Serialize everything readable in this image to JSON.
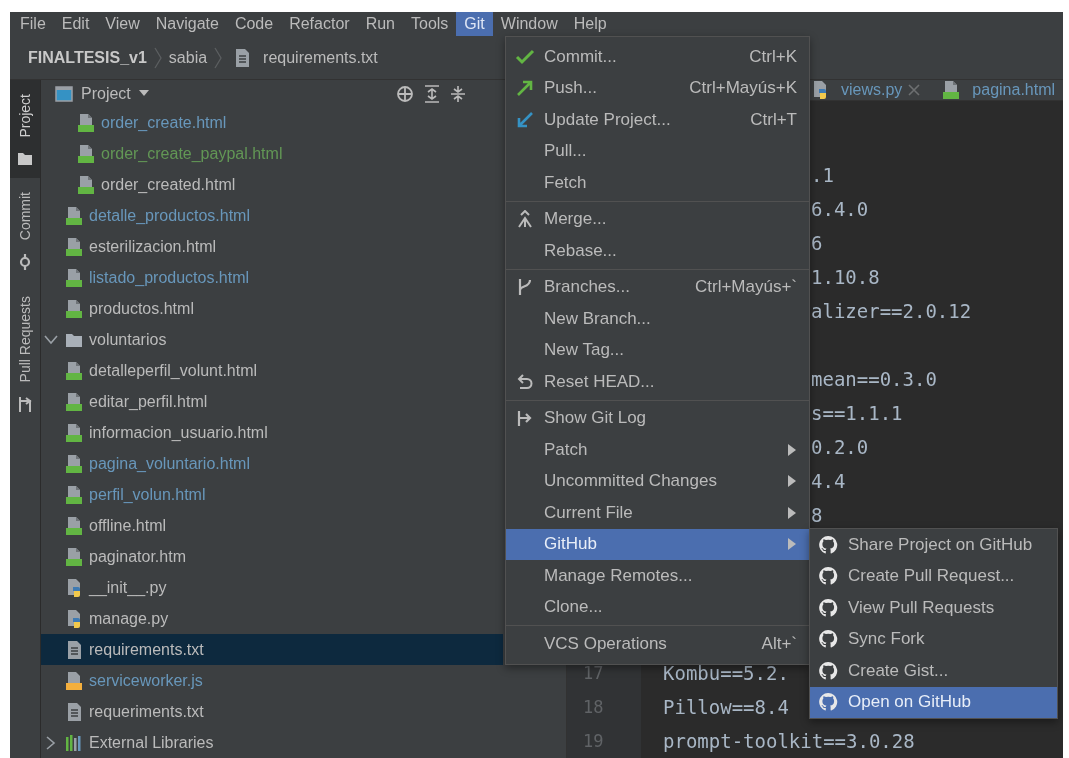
{
  "menu_bar": [
    {
      "label": "File",
      "selected": false
    },
    {
      "label": "Edit",
      "selected": false
    },
    {
      "label": "View",
      "selected": false
    },
    {
      "label": "Navigate",
      "selected": false
    },
    {
      "label": "Code",
      "selected": false
    },
    {
      "label": "Refactor",
      "selected": false
    },
    {
      "label": "Run",
      "selected": false
    },
    {
      "label": "Tools",
      "selected": false
    },
    {
      "label": "Git",
      "selected": true
    },
    {
      "label": "Window",
      "selected": false
    },
    {
      "label": "Help",
      "selected": false
    }
  ],
  "breadcrumb": [
    {
      "label": "FINALTESIS_v1",
      "kind": "project"
    },
    {
      "label": "sabia",
      "kind": "folder"
    },
    {
      "label": "requirements.txt",
      "kind": "file"
    }
  ],
  "tool_stripe": [
    {
      "label": "Project",
      "kind": "folder",
      "selected": true
    },
    {
      "label": "Commit",
      "kind": "commit",
      "selected": false
    },
    {
      "label": "Pull Requests",
      "kind": "pullrequest",
      "selected": false
    }
  ],
  "project_panel": {
    "title": "Project",
    "tree": [
      {
        "children": [
          {
            "children": [
              {
                "children": [
                  {
                    "children": [
                      {
                        "children": [
                          {
                            "label": "order_create.html",
                            "kind": "html",
                            "color": "#6897bb",
                            "selected": false
                          },
                          {
                            "label": "order_create_paypal.html",
                            "kind": "html",
                            "color": "#629755",
                            "selected": false
                          },
                          {
                            "label": "order_created.html",
                            "kind": "html",
                            "color": "#bbbbbb",
                            "selected": false
                          }
                        ]
                      },
                      {
                        "label": "detalle_productos.html",
                        "kind": "html",
                        "color": "#6897bb",
                        "selected": false
                      },
                      {
                        "label": "esterilizacion.html",
                        "kind": "html",
                        "color": "#bbbbbb",
                        "selected": false
                      },
                      {
                        "label": "listado_productos.html",
                        "kind": "html",
                        "color": "#6897bb",
                        "selected": false
                      },
                      {
                        "label": "productos.html",
                        "kind": "html",
                        "color": "#bbbbbb",
                        "selected": false
                      }
                    ]
                  },
                  {
                    "label": "voluntarios",
                    "kind": "folder",
                    "color": "#bbbbbb",
                    "selected": false,
                    "expanded": true,
                    "children": [
                      {
                        "label": "detalleperfil_volunt.html",
                        "kind": "html",
                        "color": "#bbbbbb",
                        "selected": false
                      },
                      {
                        "label": "editar_perfil.html",
                        "kind": "html",
                        "color": "#bbbbbb",
                        "selected": false
                      },
                      {
                        "label": "informacion_usuario.html",
                        "kind": "html",
                        "color": "#bbbbbb",
                        "selected": false
                      },
                      {
                        "label": "pagina_voluntario.html",
                        "kind": "html",
                        "color": "#6897bb",
                        "selected": false
                      },
                      {
                        "label": "perfil_volun.html",
                        "kind": "html",
                        "color": "#6897bb",
                        "selected": false
                      }
                    ]
                  },
                  {
                    "label": "offline.html",
                    "kind": "html",
                    "color": "#bbbbbb",
                    "selected": false
                  },
                  {
                    "label": "paginator.htm",
                    "kind": "html",
                    "color": "#bbbbbb",
                    "selected": false
                  }
                ]
              },
              {
                "label": "__init__.py",
                "kind": "python",
                "color": "#bbbbbb",
                "selected": false
              },
              {
                "label": "manage.py",
                "kind": "python",
                "color": "#bbbbbb",
                "selected": false
              },
              {
                "label": "requirements.txt",
                "kind": "text",
                "color": "#bbbbbb",
                "selected": true
              },
              {
                "label": "serviceworker.js",
                "kind": "js",
                "color": "#6897bb",
                "selected": false
              }
            ]
          },
          {
            "label": "requeriments.txt",
            "kind": "text",
            "color": "#bbbbbb",
            "selected": false
          }
        ]
      },
      {
        "label": "External Libraries",
        "kind": "library",
        "color": "#bbbbbb",
        "selected": false,
        "expanded": false
      }
    ]
  },
  "editor": {
    "tabs": [
      {
        "label": "views.py",
        "kind": "python",
        "color": "#6897bb",
        "closable": true
      },
      {
        "label": "pagina.html",
        "kind": "html",
        "color": "#6897bb",
        "closable": false
      }
    ],
    "line_blocks": [
      [
        {
          "text": ".1"
        },
        {
          "text": "6.4.0"
        },
        {
          "text": "6"
        },
        {
          "text": "1.10.8"
        },
        {
          "text": "alizer==2.0.12"
        }
      ],
      [
        {
          "text": "mean==0.3.0"
        },
        {
          "text": "s==1.1.1"
        },
        {
          "text": "0.2.0"
        },
        {
          "text": "4.4"
        },
        {
          "text": "8"
        }
      ],
      [
        {
          "number": "17",
          "text": "Kombu==5.2."
        },
        {
          "number": "18",
          "text": "Pillow==8.4"
        },
        {
          "number": "19",
          "text": "prompt-toolkit==3.0.28"
        }
      ]
    ]
  },
  "git_menu": {
    "groups": [
      [
        {
          "label": "Commit...",
          "kind": "check",
          "shortcut": "Ctrl+K",
          "submenu": false,
          "selected": false
        },
        {
          "label": "Push...",
          "kind": "push",
          "shortcut": "Ctrl+Mayús+K",
          "submenu": false,
          "selected": false
        },
        {
          "label": "Update Project...",
          "kind": "update",
          "shortcut": "Ctrl+T",
          "submenu": false,
          "selected": false
        },
        {
          "label": "Pull...",
          "kind": "plain",
          "submenu": false,
          "selected": false
        },
        {
          "label": "Fetch",
          "kind": "plain",
          "submenu": false,
          "selected": false
        }
      ],
      [
        {
          "label": "Merge...",
          "kind": "merge",
          "submenu": false,
          "selected": false
        },
        {
          "label": "Rebase...",
          "kind": "plain",
          "submenu": false,
          "selected": false
        }
      ],
      [
        {
          "label": "Branches...",
          "kind": "branch",
          "shortcut": "Ctrl+Mayús+`",
          "submenu": false,
          "selected": false
        },
        {
          "label": "New Branch...",
          "kind": "plain",
          "submenu": false,
          "selected": false
        },
        {
          "label": "New Tag...",
          "kind": "plain",
          "submenu": false,
          "selected": false
        },
        {
          "label": "Reset HEAD...",
          "kind": "reset",
          "submenu": false,
          "selected": false
        }
      ],
      [
        {
          "label": "Show Git Log",
          "kind": "log",
          "submenu": false,
          "selected": false
        },
        {
          "label": "Patch",
          "kind": "plain",
          "submenu": true,
          "selected": false
        },
        {
          "label": "Uncommitted Changes",
          "kind": "plain",
          "submenu": true,
          "selected": false
        },
        {
          "label": "Current File",
          "kind": "plain",
          "submenu": true,
          "selected": false
        },
        {
          "label": "GitHub",
          "kind": "plain",
          "submenu": true,
          "selected": true
        },
        {
          "label": "Manage Remotes...",
          "kind": "plain",
          "submenu": false,
          "selected": false
        },
        {
          "label": "Clone...",
          "kind": "plain",
          "submenu": false,
          "selected": false
        }
      ],
      [
        {
          "label": "VCS Operations",
          "kind": "plain",
          "shortcut": "Alt+`",
          "submenu": false,
          "selected": false
        }
      ]
    ]
  },
  "github_submenu": {
    "items": [
      {
        "label": "Share Project on GitHub",
        "selected": false
      },
      {
        "label": "Create Pull Request...",
        "selected": false
      },
      {
        "label": "View Pull Requests",
        "selected": false
      },
      {
        "label": "Sync Fork",
        "selected": false
      },
      {
        "label": "Create Gist...",
        "selected": false
      },
      {
        "label": "Open on GitHub",
        "selected": true
      }
    ]
  }
}
